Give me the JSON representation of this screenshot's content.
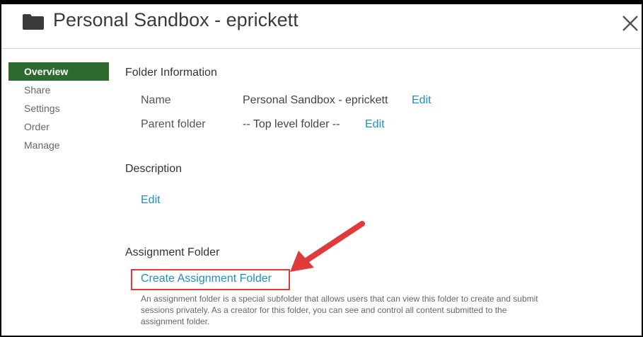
{
  "header": {
    "title": "Personal Sandbox - eprickett",
    "icon": "folder-icon",
    "close_icon": "close-icon"
  },
  "sidebar": {
    "items": [
      {
        "label": "Overview",
        "active": true
      },
      {
        "label": "Share",
        "active": false
      },
      {
        "label": "Settings",
        "active": false
      },
      {
        "label": "Order",
        "active": false
      },
      {
        "label": "Manage",
        "active": false
      }
    ]
  },
  "folder_info": {
    "heading": "Folder Information",
    "name_label": "Name",
    "name_value": "Personal Sandbox - eprickett",
    "name_edit": "Edit",
    "parent_label": "Parent folder",
    "parent_value": "-- Top level folder --",
    "parent_edit": "Edit"
  },
  "description": {
    "heading": "Description",
    "edit": "Edit"
  },
  "assignment": {
    "heading": "Assignment Folder",
    "create_link": "Create Assignment Folder",
    "help_text": "An assignment folder is a special subfolder that allows users that can view this folder to create and submit sessions privately. As a creator for this folder, you can see and control all content submitted to the assignment folder."
  },
  "colors": {
    "accent_link": "#1f8fbf",
    "active_nav": "#2d6a2d",
    "highlight": "#e03a3a"
  }
}
